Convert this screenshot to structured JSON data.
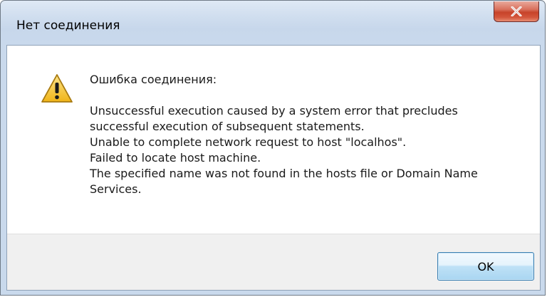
{
  "dialog": {
    "title": "Нет соединения",
    "heading": "Ошибка соединения:",
    "message_lines": [
      "Unsuccessful execution caused by a system error that precludes",
      "successful execution of subsequent statements.",
      "Unable to complete network request to host \"localhos\".",
      "Failed to locate host machine.",
      "The specified name was not found in the hosts file or Domain Name",
      "Services."
    ],
    "ok_label": "OK",
    "icon": "warning-icon"
  },
  "colors": {
    "close_button": "#c7432a",
    "ok_button_border": "#3c7fb1",
    "warning_fill": "#f3c428"
  }
}
